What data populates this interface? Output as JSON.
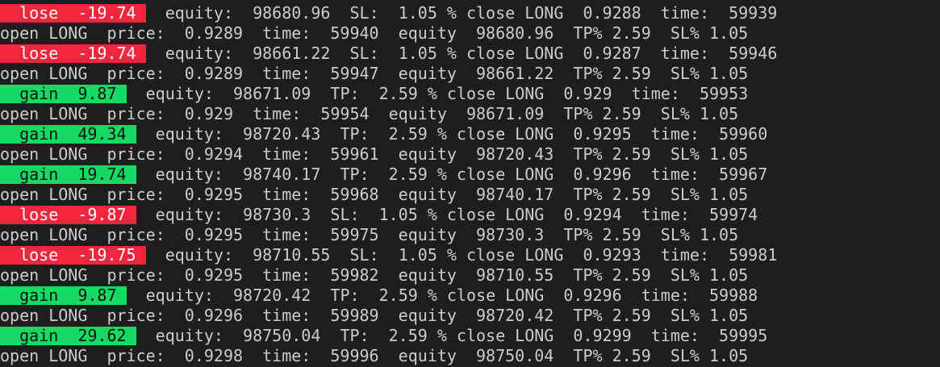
{
  "colors": {
    "background": "#1e1e1e",
    "text": "#cccccc",
    "lose_badge": "#f0263e",
    "gain_badge": "#16d964"
  },
  "lines": [
    {
      "kind": "result",
      "result": "lose",
      "badge": "  lose  -19.74 ",
      "rest": "  equity:  98680.96  SL:  1.05 % close LONG  0.9288  time:  59939"
    },
    {
      "kind": "open",
      "text": "open LONG  price:  0.9289  time:  59940  equity  98680.96  TP% 2.59  SL% 1.05"
    },
    {
      "kind": "result",
      "result": "lose",
      "badge": "  lose  -19.74 ",
      "rest": "  equity:  98661.22  SL:  1.05 % close LONG  0.9287  time:  59946"
    },
    {
      "kind": "open",
      "text": "open LONG  price:  0.9289  time:  59947  equity  98661.22  TP% 2.59  SL% 1.05"
    },
    {
      "kind": "result",
      "result": "gain",
      "badge": "  gain  9.87 ",
      "rest": "  equity:  98671.09  TP:  2.59 % close LONG  0.929  time:  59953"
    },
    {
      "kind": "open",
      "text": "open LONG  price:  0.929  time:  59954  equity  98671.09  TP% 2.59  SL% 1.05"
    },
    {
      "kind": "result",
      "result": "gain",
      "badge": "  gain  49.34 ",
      "rest": "  equity:  98720.43  TP:  2.59 % close LONG  0.9295  time:  59960"
    },
    {
      "kind": "open",
      "text": "open LONG  price:  0.9294  time:  59961  equity  98720.43  TP% 2.59  SL% 1.05"
    },
    {
      "kind": "result",
      "result": "gain",
      "badge": "  gain  19.74 ",
      "rest": "  equity:  98740.17  TP:  2.59 % close LONG  0.9296  time:  59967"
    },
    {
      "kind": "open",
      "text": "open LONG  price:  0.9295  time:  59968  equity  98740.17  TP% 2.59  SL% 1.05"
    },
    {
      "kind": "result",
      "result": "lose",
      "badge": "  lose  -9.87 ",
      "rest": "  equity:  98730.3  SL:  1.05 % close LONG  0.9294  time:  59974"
    },
    {
      "kind": "open",
      "text": "open LONG  price:  0.9295  time:  59975  equity  98730.3  TP% 2.59  SL% 1.05"
    },
    {
      "kind": "result",
      "result": "lose",
      "badge": "  lose  -19.75 ",
      "rest": "  equity:  98710.55  SL:  1.05 % close LONG  0.9293  time:  59981"
    },
    {
      "kind": "open",
      "text": "open LONG  price:  0.9295  time:  59982  equity  98710.55  TP% 2.59  SL% 1.05"
    },
    {
      "kind": "result",
      "result": "gain",
      "badge": "  gain  9.87 ",
      "rest": "  equity:  98720.42  TP:  2.59 % close LONG  0.9296  time:  59988"
    },
    {
      "kind": "open",
      "text": "open LONG  price:  0.9296  time:  59989  equity  98720.42  TP% 2.59  SL% 1.05"
    },
    {
      "kind": "result",
      "result": "gain",
      "badge": "  gain  29.62 ",
      "rest": "  equity:  98750.04  TP:  2.59 % close LONG  0.9299  time:  59995"
    },
    {
      "kind": "open",
      "text": "open LONG  price:  0.9298  time:  59996  equity  98750.04  TP% 2.59  SL% 1.05"
    }
  ]
}
